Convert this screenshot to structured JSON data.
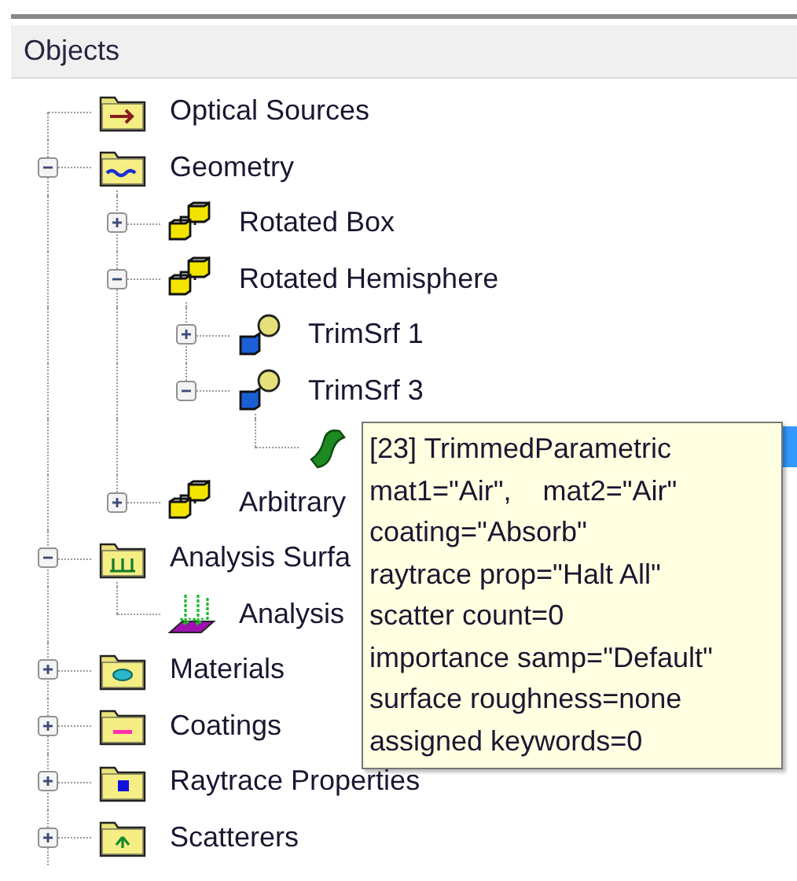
{
  "panel": {
    "title": "Objects"
  },
  "tree": [
    {
      "label": "Optical Sources",
      "kind": "source-folder",
      "selected": false
    },
    {
      "label": "Geometry",
      "kind": "geometry-folder",
      "expanded": true,
      "selected": false,
      "children": [
        {
          "label": "Rotated Box",
          "kind": "cubes",
          "expanded": false,
          "selected": false
        },
        {
          "label": "Rotated Hemisphere",
          "kind": "cubes",
          "expanded": true,
          "selected": false,
          "children": [
            {
              "label": "TrimSrf 1",
              "kind": "trim-surface",
              "expanded": false,
              "selected": false
            },
            {
              "label": "TrimSrf 3",
              "kind": "trim-surface",
              "expanded": true,
              "selected": false,
              "children": [
                {
                  "kind": "patch",
                  "selected": true
                }
              ]
            }
          ]
        },
        {
          "label": "Arbitrary",
          "kind": "cubes",
          "expanded": false,
          "selected": false
        }
      ]
    },
    {
      "label": "Analysis Surfa",
      "kind": "analysis-folder",
      "expanded": true,
      "selected": false,
      "children": [
        {
          "label": "Analysis",
          "kind": "analysis-surface",
          "selected": false
        }
      ]
    },
    {
      "label": "Materials",
      "kind": "materials-folder",
      "expanded": false,
      "selected": false
    },
    {
      "label": "Coatings",
      "kind": "coatings-folder",
      "expanded": false,
      "selected": false
    },
    {
      "label": "Raytrace Properties",
      "kind": "raytrace-folder",
      "expanded": false,
      "selected": false
    },
    {
      "label": "Scatterers",
      "kind": "scatterers-folder",
      "expanded": false,
      "selected": false
    }
  ],
  "tooltip": {
    "lines": [
      "[23] TrimmedParametric",
      "mat1=\"Air\",    mat2=\"Air\"",
      "coating=\"Absorb\"",
      "raytrace prop=\"Halt All\"",
      "scatter count=0",
      "importance samp=\"Default\"",
      "surface roughness=none",
      "assigned keywords=0"
    ]
  }
}
